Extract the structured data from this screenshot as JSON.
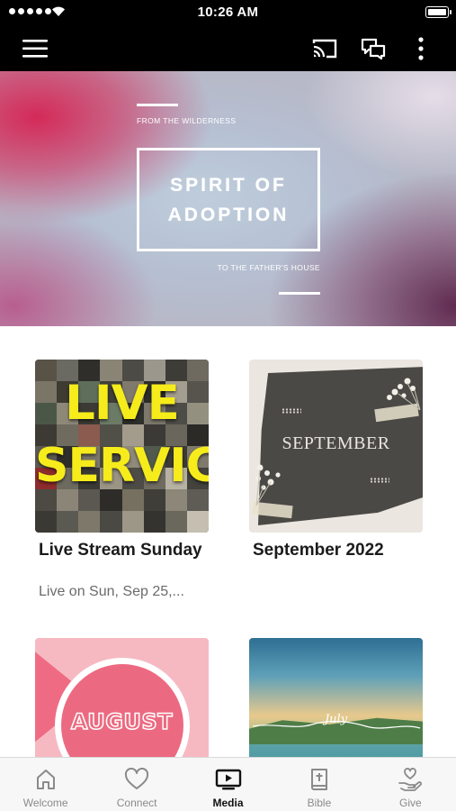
{
  "status_bar": {
    "time": "10:26 AM"
  },
  "hero": {
    "kicker": "FROM THE WILDERNESS",
    "title_line1": "SPIRIT OF",
    "title_line2": "ADOPTION",
    "footer": "TO THE FATHER'S HOUSE"
  },
  "media_items": [
    {
      "title": "Live Stream Sunday",
      "subtitle": "Live on Sun, Sep 25,...",
      "thumb_line1": "LIVE",
      "thumb_line2": "SERVICE"
    },
    {
      "title": "September 2022",
      "subtitle": "",
      "thumb_text": "SEPTEMBER"
    },
    {
      "title": "",
      "subtitle": "",
      "thumb_text": "AUGUST"
    },
    {
      "title": "",
      "subtitle": "",
      "thumb_text": "July"
    }
  ],
  "tabs": [
    {
      "label": "Welcome",
      "icon": "home-icon"
    },
    {
      "label": "Connect",
      "icon": "heart-icon"
    },
    {
      "label": "Media",
      "icon": "tv-play-icon"
    },
    {
      "label": "Bible",
      "icon": "bible-icon"
    },
    {
      "label": "Give",
      "icon": "give-hand-heart-icon"
    }
  ],
  "active_tab": "Media",
  "colors": {
    "nav_bg": "#000000",
    "live_text": "#f6ec1b",
    "tab_active": "#111111",
    "tab_inactive": "#8a8a8a"
  }
}
